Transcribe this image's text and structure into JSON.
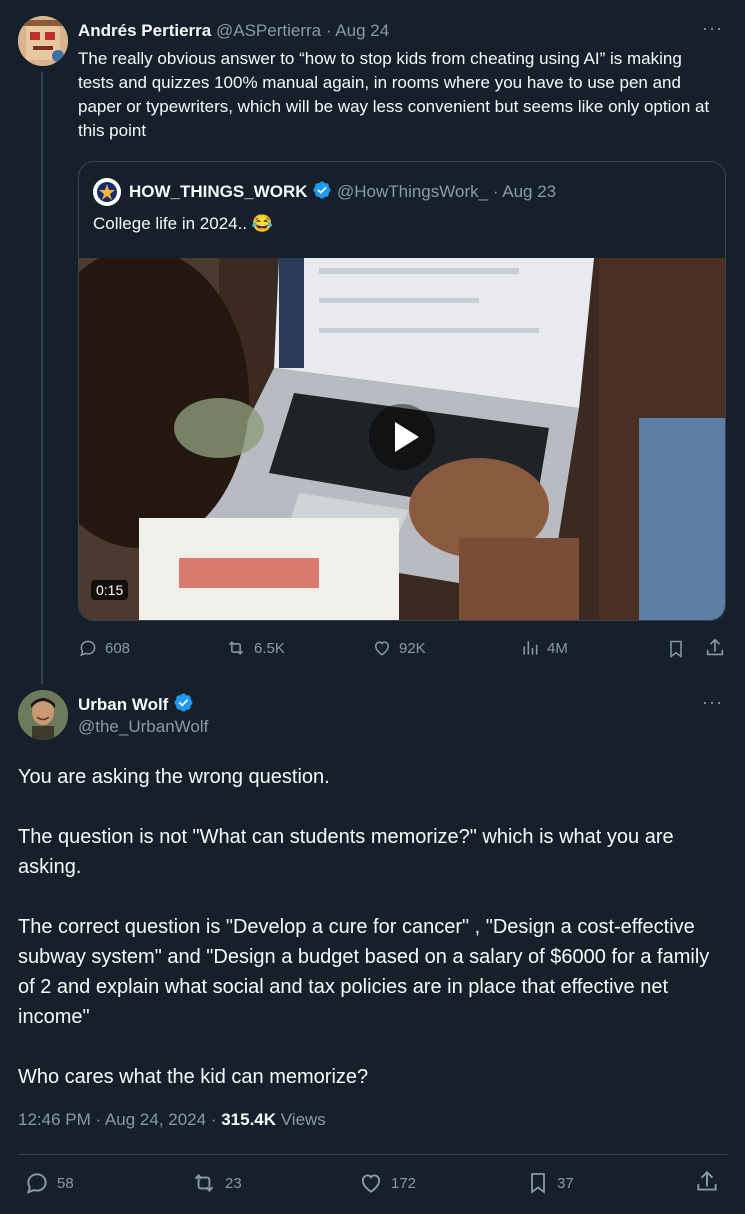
{
  "parent_tweet": {
    "author_name": "Andrés Pertierra",
    "handle": "@ASPertierra",
    "date": "· Aug 24",
    "more": "···",
    "text": "The really obvious answer to “how to stop kids from cheating using AI” is making tests and quizzes 100% manual again, in rooms where you have to use pen and paper or typewriters, which will be way less convenient but seems like only option at this point",
    "quote": {
      "author_name": "HOW_THINGS_WORK",
      "handle": "@HowThingsWork_",
      "date": "· Aug 23",
      "text": "College life in 2024.. 😂",
      "video_duration": "0:15"
    },
    "stats": {
      "replies": "608",
      "reposts": "6.5K",
      "likes": "92K",
      "views": "4M"
    }
  },
  "reply_tweet": {
    "author_name": "Urban Wolf",
    "handle": "@the_UrbanWolf",
    "more": "···",
    "paragraphs": [
      "You are asking the wrong question.",
      "The question is not \"What can students memorize?\" which is what you are asking.",
      "The correct question is \"Develop a cure for cancer\" , \"Design a cost-effective subway system\" and \"Design a budget based on a salary of $6000 for a family of 2 and explain what social and tax policies are in place that effective net income\"",
      "Who cares what the kid can memorize?"
    ],
    "timestamp": "12:46 PM · Aug 24, 2024 ·",
    "views_count": "315.4K",
    "views_label": "Views",
    "stats": {
      "replies": "58",
      "reposts": "23",
      "likes": "172",
      "bookmarks": "37"
    }
  },
  "colors": {
    "background": "#15202b",
    "text": "#f7f9f9",
    "muted": "#8b98a5",
    "verified": "#1d9bf0",
    "border": "#38444d"
  }
}
